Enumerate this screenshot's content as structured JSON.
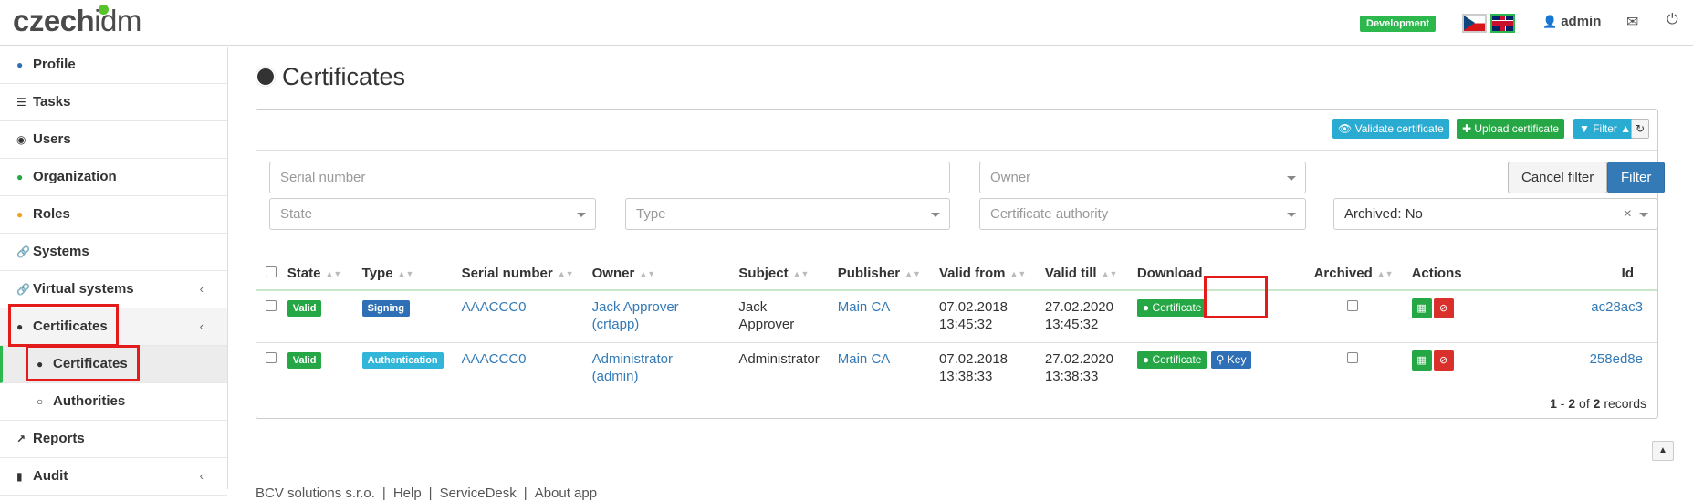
{
  "app": {
    "logo_main": "czech",
    "logo_accent": "idm",
    "env_badge": "Development",
    "user": "admin"
  },
  "sidebar": {
    "items": [
      {
        "label": "Profile",
        "icon": "user-icon"
      },
      {
        "label": "Tasks",
        "icon": "tasks-icon"
      },
      {
        "label": "Users",
        "icon": "users-icon"
      },
      {
        "label": "Organization",
        "icon": "tree-icon"
      },
      {
        "label": "Roles",
        "icon": "roles-icon"
      },
      {
        "label": "Systems",
        "icon": "link-icon"
      },
      {
        "label": "Virtual systems",
        "icon": "link-icon"
      },
      {
        "label": "Certificates",
        "icon": "certificate-icon"
      },
      {
        "label": "Certificates",
        "icon": "certificate-icon"
      },
      {
        "label": "Authorities",
        "icon": "circle-icon"
      },
      {
        "label": "Reports",
        "icon": "chart-icon"
      },
      {
        "label": "Audit",
        "icon": "bar-chart-icon"
      }
    ]
  },
  "page": {
    "title": "Certificates"
  },
  "toolbar": {
    "validate": "Validate certificate",
    "upload": "Upload certificate",
    "filter": "Filter"
  },
  "filter": {
    "serial_placeholder": "Serial number",
    "owner_placeholder": "Owner",
    "state_placeholder": "State",
    "type_placeholder": "Type",
    "authority_placeholder": "Certificate authority",
    "archived_value": "Archived: No",
    "cancel_label": "Cancel filter",
    "apply_label": "Filter"
  },
  "table": {
    "columns": [
      "State",
      "Type",
      "Serial number",
      "Owner",
      "Subject",
      "Publisher",
      "Valid from",
      "Valid till",
      "Download",
      "Archived",
      "Actions",
      "Id"
    ],
    "rows": [
      {
        "state": "Valid",
        "type": "Signing",
        "serial": "AAACCC0",
        "owner": "Jack Approver (crtapp)",
        "subject": "Jack Approver",
        "publisher": "Main CA",
        "valid_from_date": "07.02.2018",
        "valid_from_time": "13:45:32",
        "valid_till_date": "27.02.2020",
        "valid_till_time": "13:45:32",
        "download_cert": "Certificate",
        "id": "ac28ac3"
      },
      {
        "state": "Valid",
        "type": "Authentication",
        "serial": "AAACCC0",
        "owner": "Administrator (admin)",
        "subject": "Administrator",
        "publisher": "Main CA",
        "valid_from_date": "07.02.2018",
        "valid_from_time": "13:38:33",
        "valid_till_date": "27.02.2020",
        "valid_till_time": "13:38:33",
        "download_cert": "Certificate",
        "download_key": "Key",
        "id": "258ed8e"
      }
    ],
    "records": {
      "from": "1",
      "to": "2",
      "of": "of",
      "total": "2",
      "suffix": "records"
    }
  },
  "footer": {
    "company": "BCV solutions s.r.o.",
    "help": "Help",
    "servicedesk": "ServiceDesk",
    "about": "About app"
  }
}
